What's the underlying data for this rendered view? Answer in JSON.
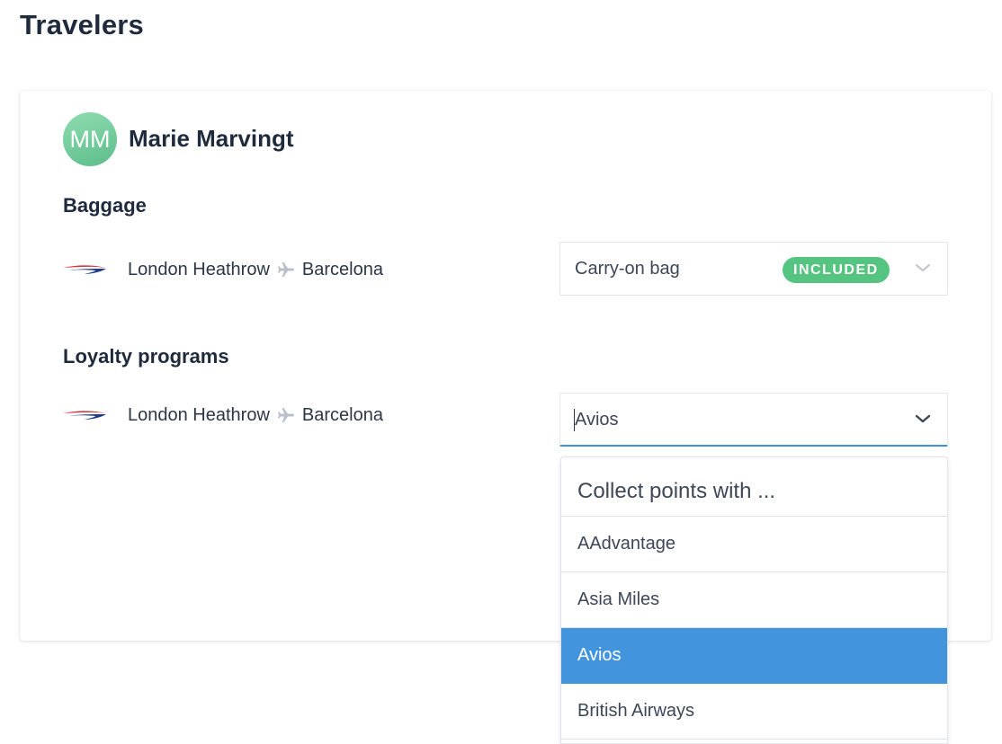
{
  "page": {
    "title": "Travelers"
  },
  "traveler": {
    "initials": "MM",
    "name": "Marie Marvingt",
    "avatar_color": "#6fcd9b"
  },
  "baggage": {
    "heading": "Baggage",
    "route": {
      "origin": "London Heathrow",
      "destination": "Barcelona",
      "airline_icon": "british-airways-speedmarque-icon",
      "separator_icon": "airplane-icon"
    },
    "select": {
      "value": "Carry-on bag",
      "badge": "INCLUDED",
      "badge_color": "#56c481"
    }
  },
  "loyalty": {
    "heading": "Loyalty programs",
    "route": {
      "origin": "London Heathrow",
      "destination": "Barcelona",
      "airline_icon": "british-airways-speedmarque-icon",
      "separator_icon": "airplane-icon"
    },
    "select": {
      "value": "Avios",
      "accent_color": "#3f8fd6"
    },
    "dropdown": {
      "header": "Collect points with ...",
      "options": [
        {
          "label": "AAdvantage",
          "selected": false
        },
        {
          "label": "Asia Miles",
          "selected": false
        },
        {
          "label": "Avios",
          "selected": true
        },
        {
          "label": "British Airways",
          "selected": false
        }
      ],
      "selected_color": "#4295dd"
    }
  }
}
